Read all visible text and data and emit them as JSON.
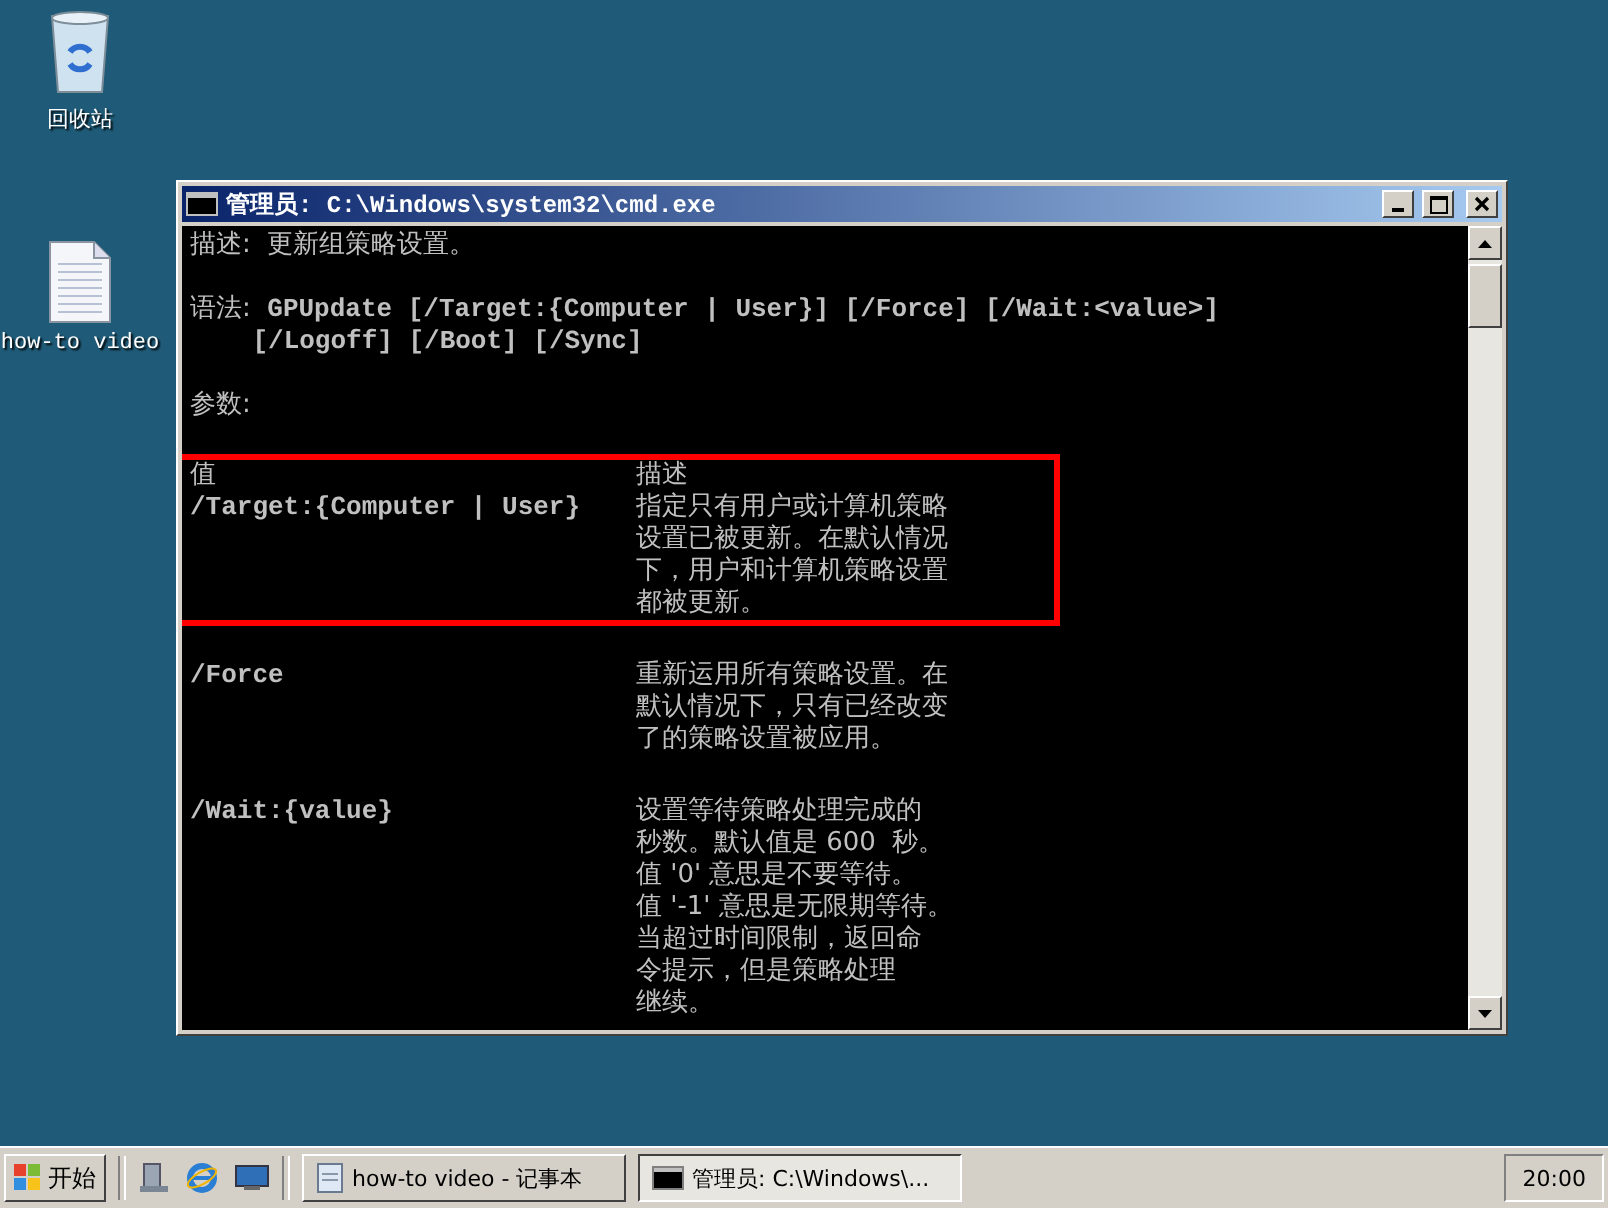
{
  "desktop_icons": [
    {
      "kind": "recycle",
      "label": "回收站"
    },
    {
      "kind": "document",
      "label": "how-to video"
    }
  ],
  "window": {
    "title": "管理员: C:\\Windows\\system32\\cmd.exe",
    "console": {
      "description": {
        "label": "描述:",
        "text": "更新组策略设置。"
      },
      "syntax": {
        "label": "语法:",
        "lines": [
          "GPUpdate [/Target:{Computer | User}] [/Force] [/Wait:<value>]",
          "[/Logoff] [/Boot] [/Sync]"
        ]
      },
      "parameters_label": "参数:",
      "columns": [
        "值",
        "描述"
      ],
      "rows": [
        {
          "name": "/Target:{Computer | User}",
          "highlighted": true,
          "description": [
            "指定只有用户或计算机策略",
            "设置已被更新。在默认情况",
            "下，用户和计算机策略设置",
            "都被更新。"
          ]
        },
        {
          "name": "/Force",
          "highlighted": false,
          "description": [
            "重新运用所有策略设置。在",
            "默认情况下，只有已经改变",
            "了的策略设置被应用。"
          ]
        },
        {
          "name": "/Wait:{value}",
          "highlighted": false,
          "description": [
            "设置等待策略处理完成的",
            "秒数。默认值是 600  秒。",
            "值 '0' 意思是不要等待。",
            "值 '-1' 意思是无限期等待。",
            "当超过时间限制，返回命",
            "令提示，但是策略处理",
            "继续。"
          ]
        }
      ]
    }
  },
  "taskbar": {
    "start": "开始",
    "tasks": [
      {
        "kind": "notepad",
        "label": "how-to video - 记事本",
        "selected": false
      },
      {
        "kind": "console",
        "label": "管理员: C:\\Windows\\...",
        "selected": true
      }
    ],
    "clock": "20:00"
  }
}
